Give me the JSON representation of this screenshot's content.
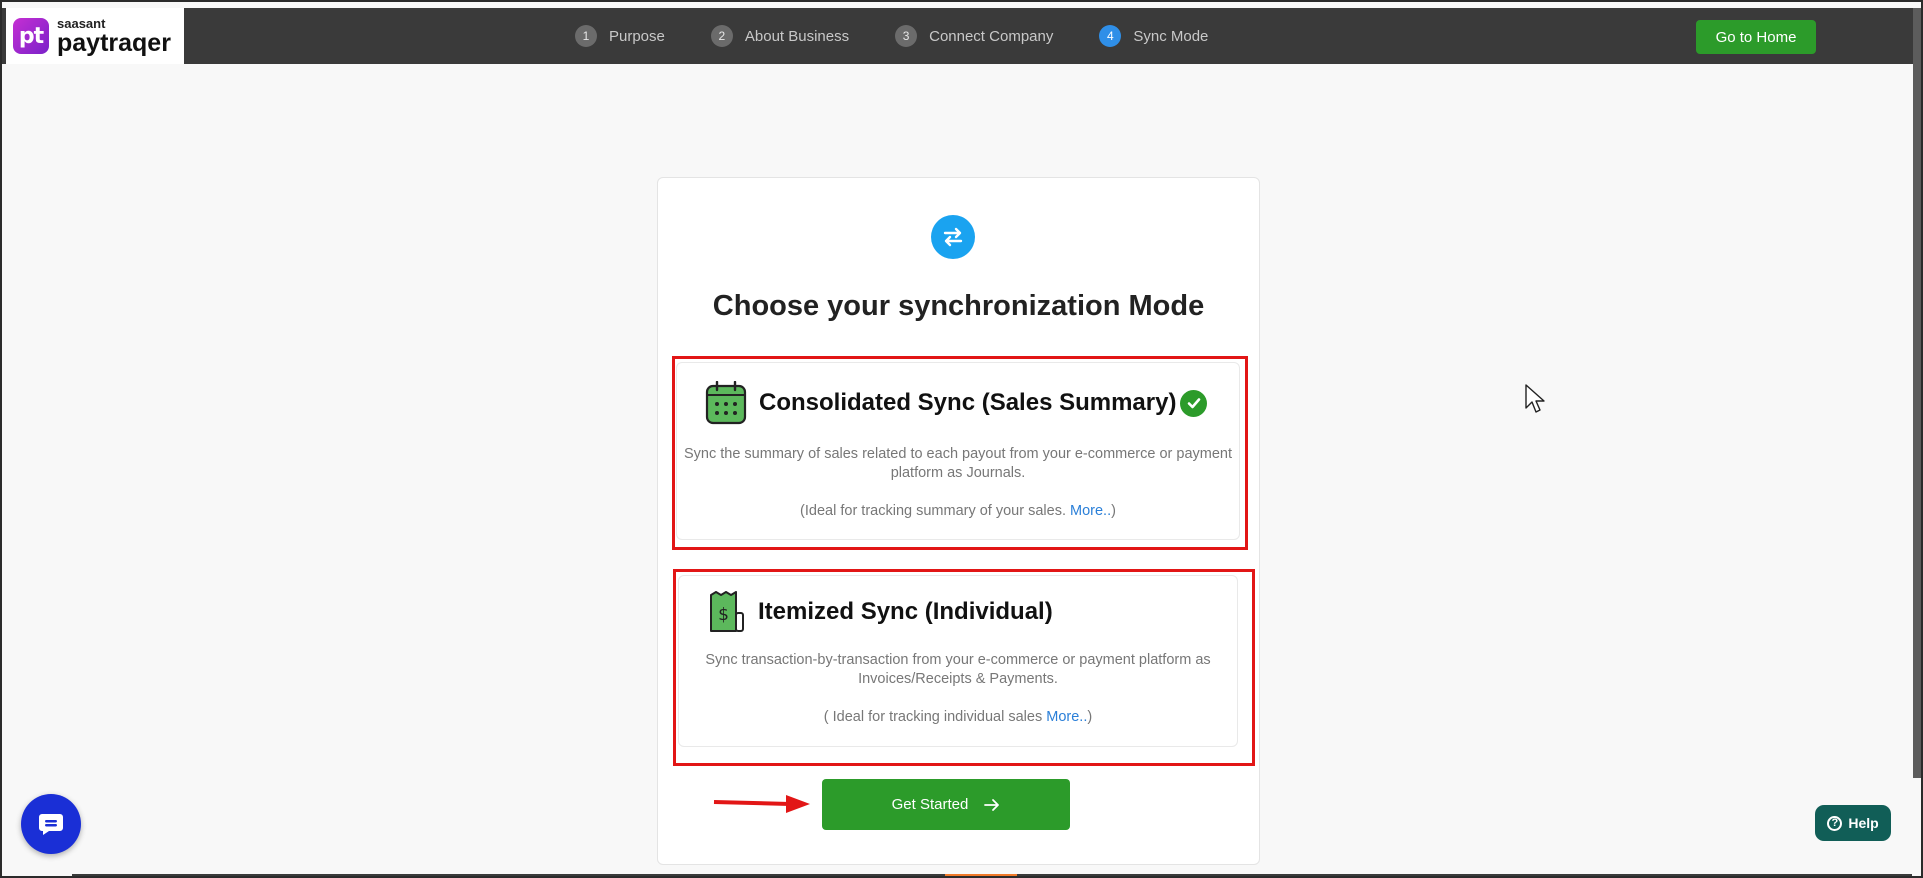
{
  "brand": {
    "small": "saasant",
    "big": "paytraqer",
    "mark": "pt"
  },
  "steps": [
    {
      "num": "1",
      "label": "Purpose"
    },
    {
      "num": "2",
      "label": "About Business"
    },
    {
      "num": "3",
      "label": "Connect Company"
    },
    {
      "num": "4",
      "label": "Sync Mode"
    }
  ],
  "header": {
    "home_label": "Go to Home"
  },
  "main": {
    "title": "Choose your synchronization Mode",
    "options": [
      {
        "title": "Consolidated Sync (Sales Summary)",
        "desc": "Sync the summary of sales related to each payout from your e-commerce or payment platform as Journals.",
        "ideal": "(Ideal for tracking summary of your sales. ",
        "more": "More..",
        "close": ")",
        "selected": true
      },
      {
        "title": "Itemized Sync (Individual)",
        "desc": "Sync transaction-by-transaction from your e-commerce or payment platform as Invoices/Receipts & Payments.",
        "ideal": "( Ideal for tracking individual sales ",
        "more": "More..",
        "close": ")",
        "selected": false
      }
    ],
    "start_label": "Get Started"
  },
  "help": {
    "label": "Help"
  },
  "colors": {
    "accent_green": "#2c9b2a",
    "highlight_red": "#e21616",
    "link_blue": "#2a7fd8",
    "sync_blue": "#1aa3f0"
  }
}
